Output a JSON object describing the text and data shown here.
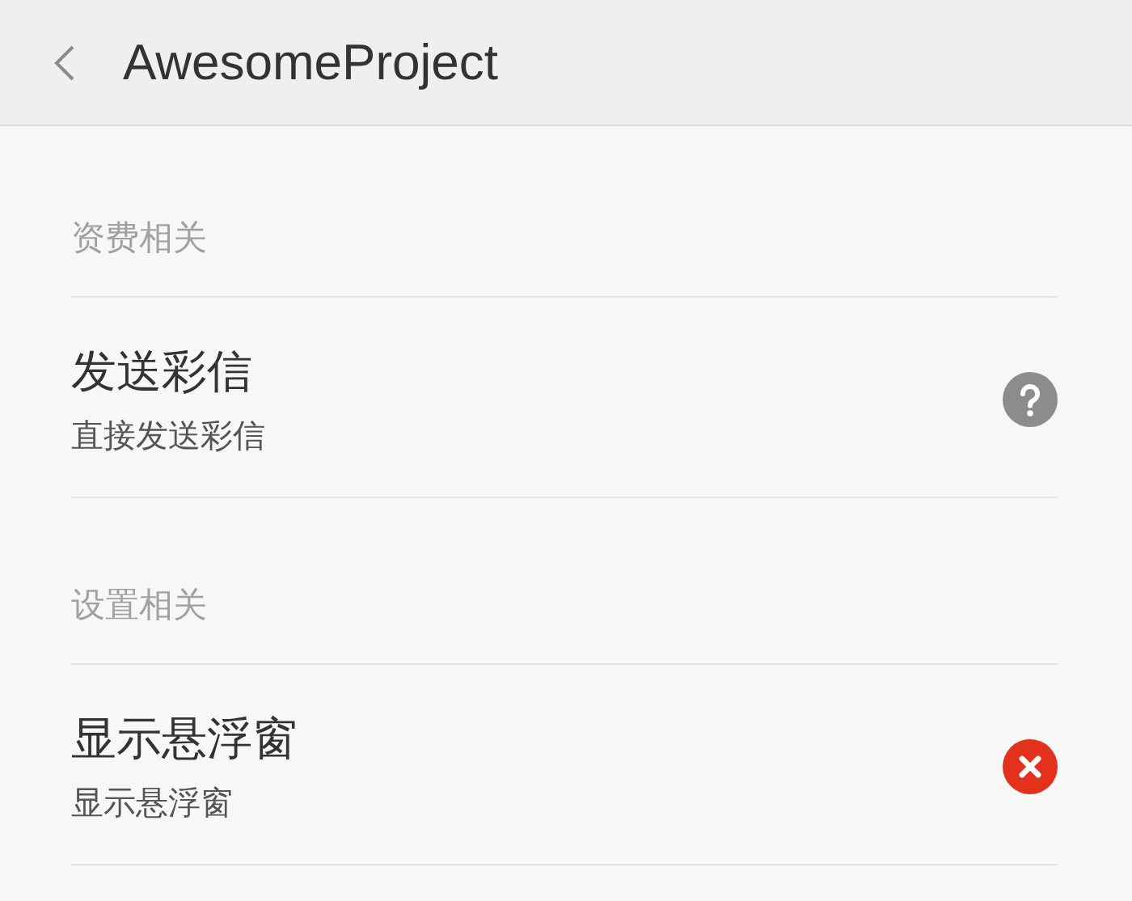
{
  "header": {
    "title": "AwesomeProject"
  },
  "sections": [
    {
      "title": "资费相关",
      "items": [
        {
          "title": "发送彩信",
          "subtitle": "直接发送彩信",
          "kind": "help"
        }
      ]
    },
    {
      "title": "设置相关",
      "items": [
        {
          "title": "显示悬浮窗",
          "subtitle": "显示悬浮窗",
          "kind": "error"
        }
      ]
    }
  ]
}
